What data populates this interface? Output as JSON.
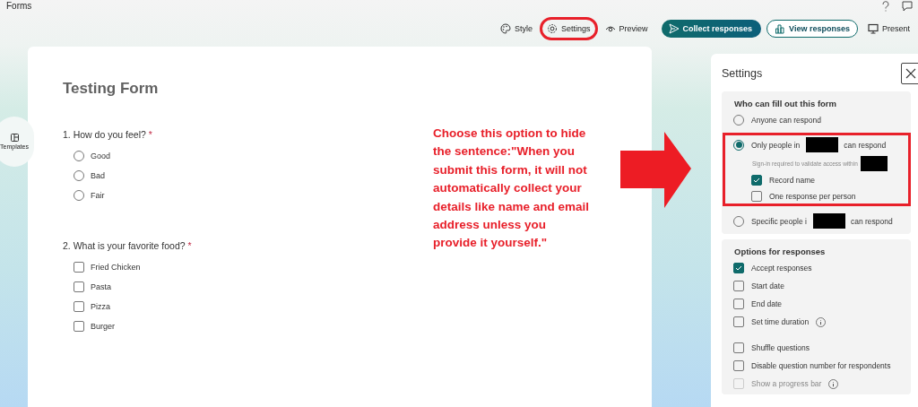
{
  "app": {
    "title": "Forms"
  },
  "toolbar": [
    {
      "kind": "link",
      "label": "Style",
      "annotated": false
    },
    {
      "kind": "link",
      "label": "Settings",
      "annotated": true
    },
    {
      "kind": "link",
      "label": "Preview",
      "annotated": false
    },
    {
      "kind": "primary",
      "label": "Collect responses",
      "annotated": false
    },
    {
      "kind": "outline",
      "label": "View responses",
      "annotated": false
    },
    {
      "kind": "link",
      "label": "Present",
      "annotated": false
    }
  ],
  "rail": {
    "label": "Templates"
  },
  "form": {
    "title": "Testing Form",
    "questions": [
      {
        "number": "1.",
        "text": "How do you feel?",
        "required_mark": "*",
        "kind": "radio",
        "options": [
          {
            "label": "Good",
            "selected": false
          },
          {
            "label": "Bad",
            "selected": false
          },
          {
            "label": "Fair",
            "selected": false
          }
        ]
      },
      {
        "number": "2.",
        "text": "What is your favorite food?",
        "required_mark": "*",
        "kind": "checkbox",
        "options": [
          {
            "label": "Fried Chicken",
            "checked": false
          },
          {
            "label": "Pasta",
            "checked": false
          },
          {
            "label": "Pizza",
            "checked": false
          },
          {
            "label": "Burger",
            "checked": false
          }
        ]
      }
    ]
  },
  "annotation": {
    "text": "Choose this option to hide the sentence:\"When you submit this form, it will not automatically collect your details like name and email address unless you provide it yourself.\""
  },
  "settings": {
    "title": "Settings",
    "sections": [
      {
        "heading": "Who can fill out this form",
        "items": [
          {
            "kind": "radio",
            "label": "Anyone can respond",
            "selected": false,
            "annotated": false
          },
          {
            "kind": "radio",
            "label": "Only people in",
            "label_after": "can respond",
            "redacted": true,
            "selected": true,
            "annotated": true,
            "note": "Sign-in required to validate access within",
            "sub": [
              {
                "label": "Record name",
                "checked": true
              },
              {
                "label": "One response per person",
                "checked": false
              }
            ]
          },
          {
            "kind": "radio",
            "label": "Specific people i",
            "label_after": "can respond",
            "redacted": true,
            "selected": false,
            "annotated": false
          }
        ]
      },
      {
        "heading": "Options for responses",
        "items": [
          {
            "kind": "checkbox",
            "label": "Accept responses",
            "checked": true,
            "info": false,
            "separated": false,
            "disabled": false
          },
          {
            "kind": "checkbox",
            "label": "Start date",
            "checked": false,
            "info": false,
            "separated": false,
            "disabled": false
          },
          {
            "kind": "checkbox",
            "label": "End date",
            "checked": false,
            "info": false,
            "separated": false,
            "disabled": false
          },
          {
            "kind": "checkbox",
            "label": "Set time duration",
            "checked": false,
            "info": true,
            "separated": false,
            "disabled": false
          },
          {
            "kind": "checkbox",
            "label": "Shuffle questions",
            "checked": false,
            "info": false,
            "separated": true,
            "disabled": false
          },
          {
            "kind": "checkbox",
            "label": "Disable question number for respondents",
            "checked": false,
            "info": false,
            "separated": false,
            "disabled": false
          },
          {
            "kind": "checkbox",
            "label": "Show a progress bar",
            "checked": false,
            "info": true,
            "separated": false,
            "disabled": true
          }
        ]
      }
    ]
  }
}
